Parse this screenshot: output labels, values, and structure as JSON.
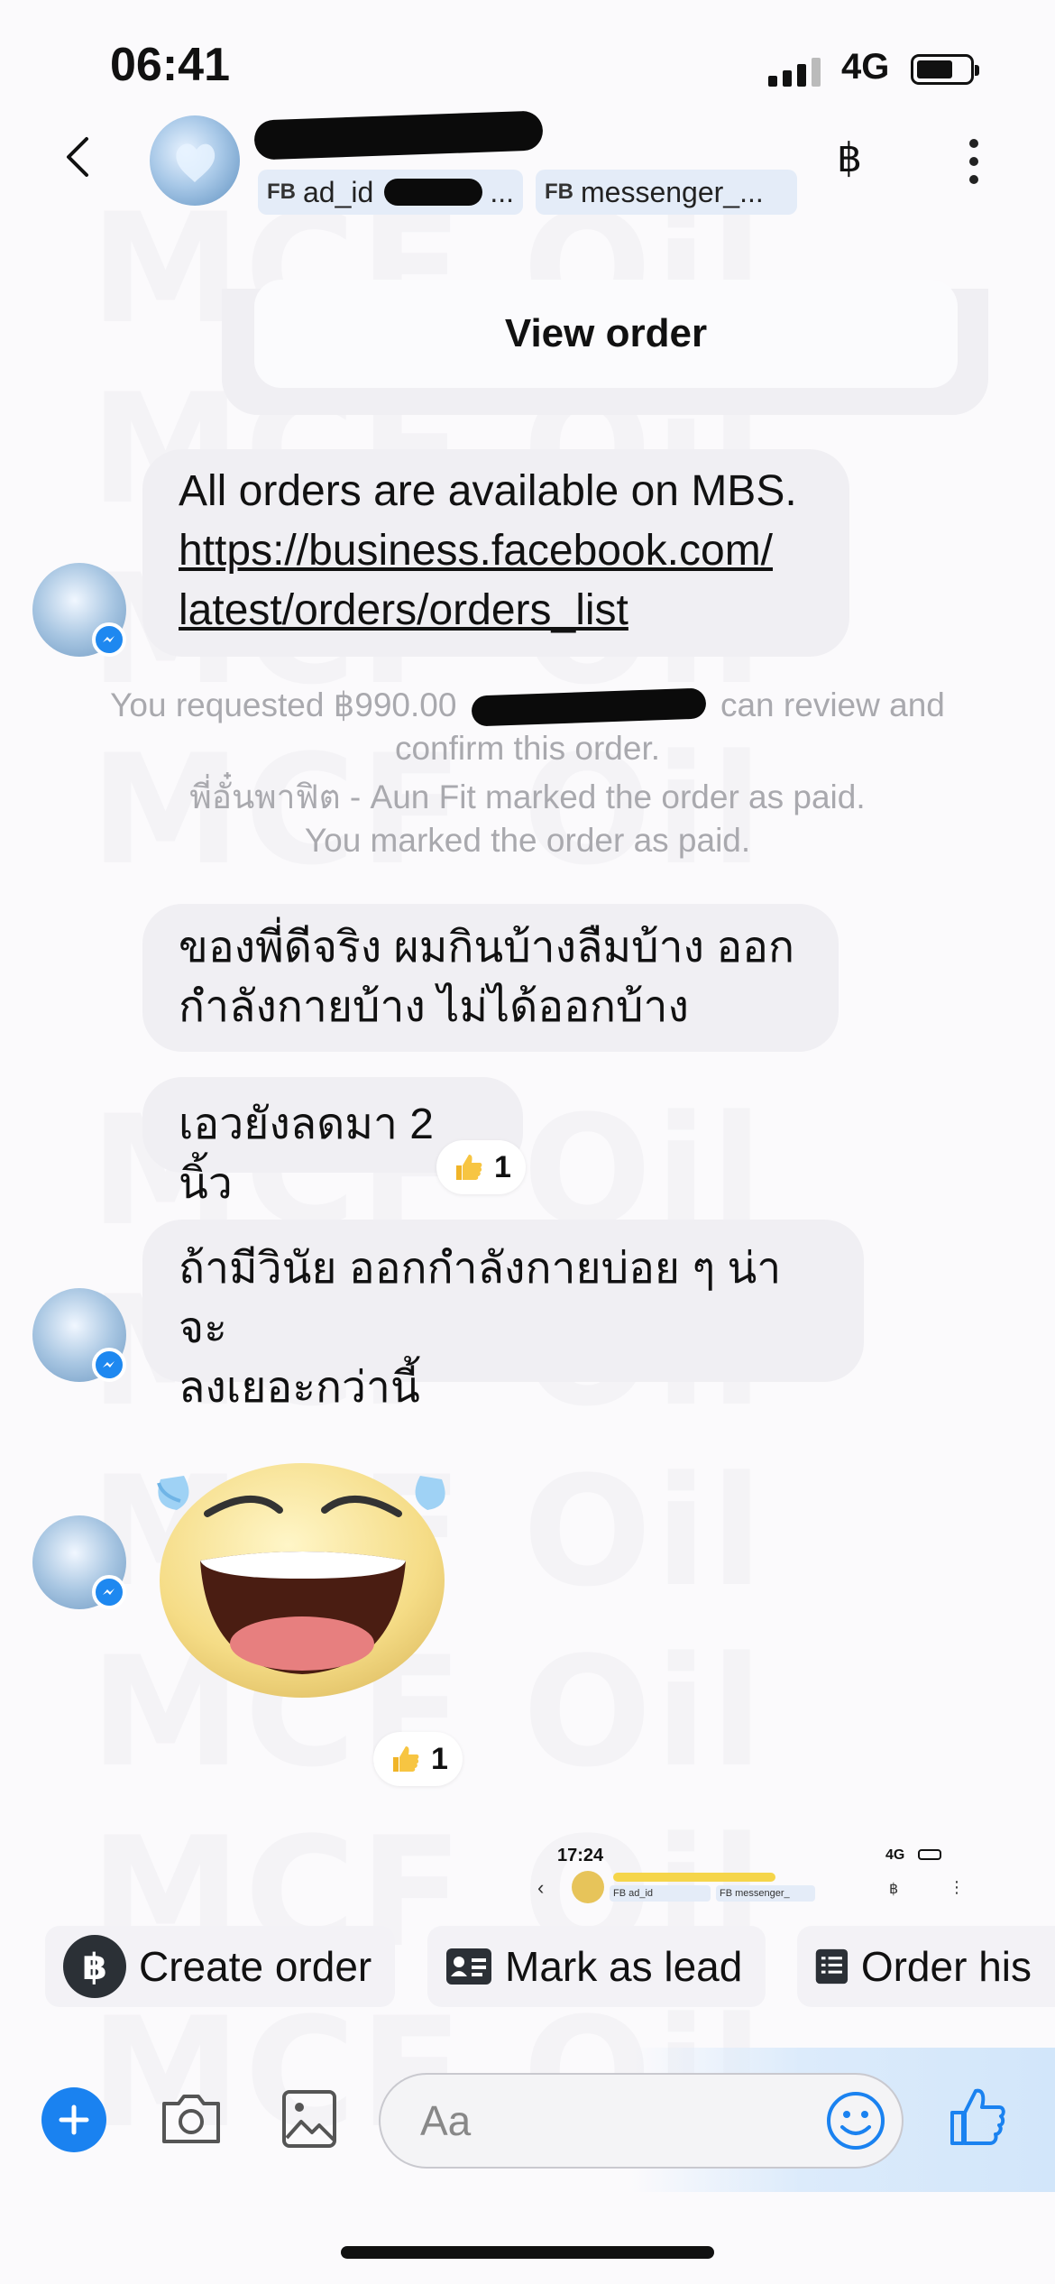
{
  "status_bar": {
    "time": "06:41",
    "network": "4G"
  },
  "header": {
    "tags": [
      {
        "prefix": "FB",
        "label": "ad_id"
      },
      {
        "prefix": "FB",
        "label": "messenger_..."
      }
    ],
    "currency_icon": "฿"
  },
  "order_card": {
    "button_label": "View order"
  },
  "messages": {
    "mbs_line1": "All orders are available on MBS.",
    "mbs_link_line1": "https://business.facebook.com/",
    "mbs_link_line2": "latest/orders/orders_list",
    "sys_requested_a": "You requested ฿990.00",
    "sys_requested_b": "can review and",
    "sys_requested_c": "confirm this order.",
    "sys_paid_1": "พี่อั๋นพาฟิต - Aun Fit marked the order as paid.",
    "sys_paid_2": "You marked the order as paid.",
    "out_1_line1": "ของพี่ดีจริง ผมกินบ้างลืมบ้าง ออก",
    "out_1_line2": "กำลังกายบ้าง ไม่ได้ออกบ้าง",
    "out_2": "เอวยังลดมา 2 นิ้ว",
    "out_2_reaction_count": "1",
    "in_1_line1": "ถ้ามีวินัย ออกกำลังกายบ่อย ๆ น่าจะ",
    "in_1_line2": "ลงเยอะกว่านี้",
    "emoji_reaction_count": "1"
  },
  "embedded_shot": {
    "time": "17:24",
    "network": "4G",
    "tag1": "FB ad_id",
    "tag2": "FB messenger_"
  },
  "actions": [
    {
      "label": "Create order",
      "icon": "baht-circle-icon"
    },
    {
      "label": "Mark as lead",
      "icon": "contact-card-icon"
    },
    {
      "label": "Order his",
      "icon": "list-document-icon"
    }
  ],
  "composer": {
    "placeholder": "Aa"
  },
  "watermark": "MCF Oil",
  "colors": {
    "messenger_blue": "#1a82f0",
    "bubble_gray": "#f0eff3",
    "system_text": "#a9a9ae"
  }
}
